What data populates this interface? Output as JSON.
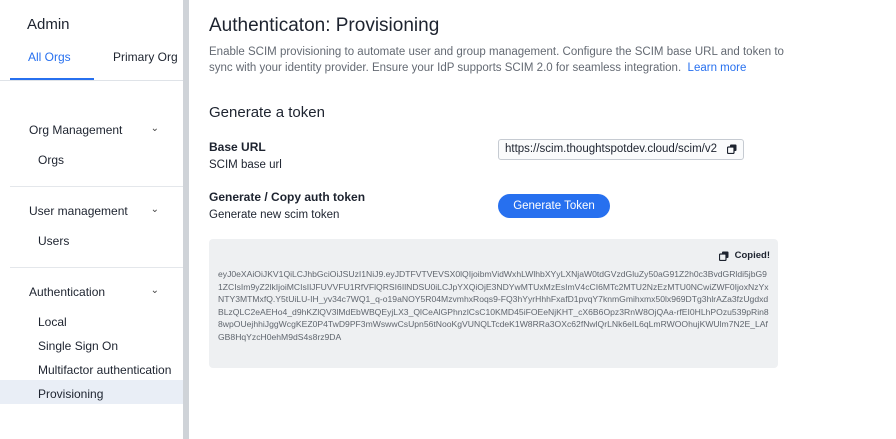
{
  "sidebar": {
    "title": "Admin",
    "tabs": [
      {
        "label": "All Orgs",
        "active": true
      },
      {
        "label": "Primary Org",
        "active": false
      }
    ],
    "sections": [
      {
        "label": "Org Management",
        "items": [
          "Orgs"
        ]
      },
      {
        "label": "User management",
        "items": [
          "Users"
        ]
      },
      {
        "label": "Authentication",
        "items": [
          "Local",
          "Single Sign On",
          "Multifactor authentication",
          "Provisioning"
        ]
      }
    ],
    "active_item": "Provisioning",
    "chevron_icon": "chevron-down-icon"
  },
  "main": {
    "title": "Authenticaton: Provisioning",
    "description": "Enable SCIM provisioning to automate user and group management. Configure the SCIM base URL and token to sync with your identity provider. Ensure your IdP supports SCIM 2.0 for seamless integration.",
    "learn_more": "Learn more",
    "section_title": "Generate a token",
    "base_url_label": "Base URL",
    "base_url_sub": "SCIM base url",
    "base_url_value": "https://scim.thoughtspotdev.cloud/scim/v2",
    "token_label": "Generate / Copy auth token",
    "token_sub": "Generate new scim token",
    "generate_button": "Generate Token",
    "copied_label": "Copied!",
    "token_value": "eyJ0eXAiOiJKV1QiLCJhbGciOiJSUzI1NiJ9.eyJDTFVTVEVSX0lQIjoibmVidWxhLWlhbXYyLXNjaW0tdGVzdGluZy50aG91Z2h0c3BvdGRldi5jbG91ZCIsIm9yZ2lkIjoiMCIsIlJFUVVFU1RfVFlQRSI6IlNDSU0iLCJpYXQiOjE3NDYwMTUxMzEsImV4cCI6MTc2MTU2NzEzMTU0NCwiZWF0IjoxNzYxNTY3MTMxfQ.Y5tUiLU-IH_yv34c7WQ1_q-o19aNOY5R04MzvmhxRoqs9-FQ3hYyrHhhFxafD1pvqY7knmGmihxmx50lx969DTg3hlrAZa3fzUgdxdBLzQLC2eAEHo4_d9hKZlQV3lMdEbWBQEyjLX3_QlCeAlGPhnzlCsC10KMD45iFOEeNjKHT_cX6B6Opz3RnW8OjQAa-rfEI0HLhPOzu539pRin88wpOUejhhiJggWcgKEZ0P4TwD9PF3mWswwCsUpn56tNooKgVUNQLTcdeK1W8RRa3OXc62fNwlQrLNk6eIL6qLmRWOOhujKWUlm7N2E_LAfGB8HqYzcH0ehM9dS4s8rz9DA",
    "copy_icon": "copy-icon"
  }
}
